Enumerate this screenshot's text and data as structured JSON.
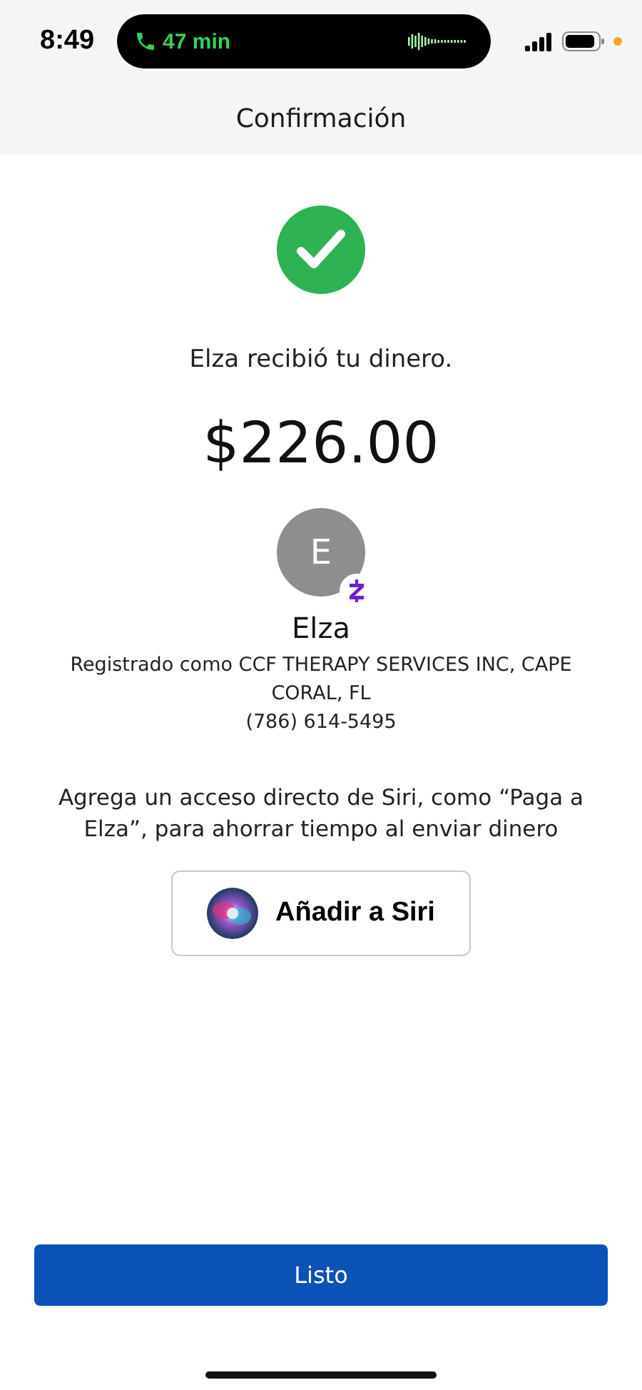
{
  "status_bar": {
    "time": "8:49",
    "call_duration": "47 min"
  },
  "header": {
    "title": "Confirmación"
  },
  "message": "Elza recibió tu dinero.",
  "amount": "$226.00",
  "recipient": {
    "initial": "E",
    "name": "Elza",
    "registered": "Registrado como CCF THERAPY SERVICES INC, CAPE CORAL, FL",
    "phone": "(786) 614-5495"
  },
  "siri": {
    "hint": "Agrega un acceso directo de Siri, como “Paga a Elza”, para ahorrar tiempo al enviar dinero",
    "button": "Añadir a Siri"
  },
  "done_button": "Listo"
}
